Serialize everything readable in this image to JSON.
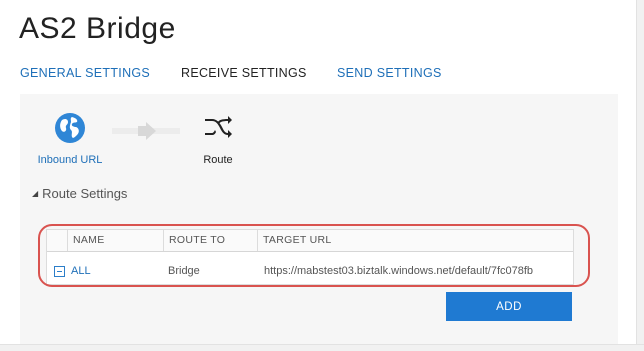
{
  "page": {
    "title": "AS2 Bridge"
  },
  "tabs": [
    {
      "label": "GENERAL SETTINGS",
      "active": false
    },
    {
      "label": "RECEIVE SETTINGS",
      "active": true
    },
    {
      "label": "SEND SETTINGS",
      "active": false
    }
  ],
  "pipeline": {
    "nodes": [
      {
        "label": "Inbound URL",
        "icon": "globe-icon"
      },
      {
        "label": "Route",
        "icon": "shuffle-icon"
      }
    ]
  },
  "route_settings": {
    "heading": "Route Settings",
    "columns": [
      "NAME",
      "ROUTE TO",
      "TARGET URL"
    ],
    "rows": [
      {
        "name": "ALL",
        "route_to": "Bridge",
        "target_url": "https://mabstest03.biztalk.windows.net/default/7fc078fb"
      }
    ],
    "add_label": "ADD"
  },
  "colors": {
    "accent": "#1e6fb8",
    "button": "#1f7ad2",
    "highlight": "#d9534f"
  }
}
